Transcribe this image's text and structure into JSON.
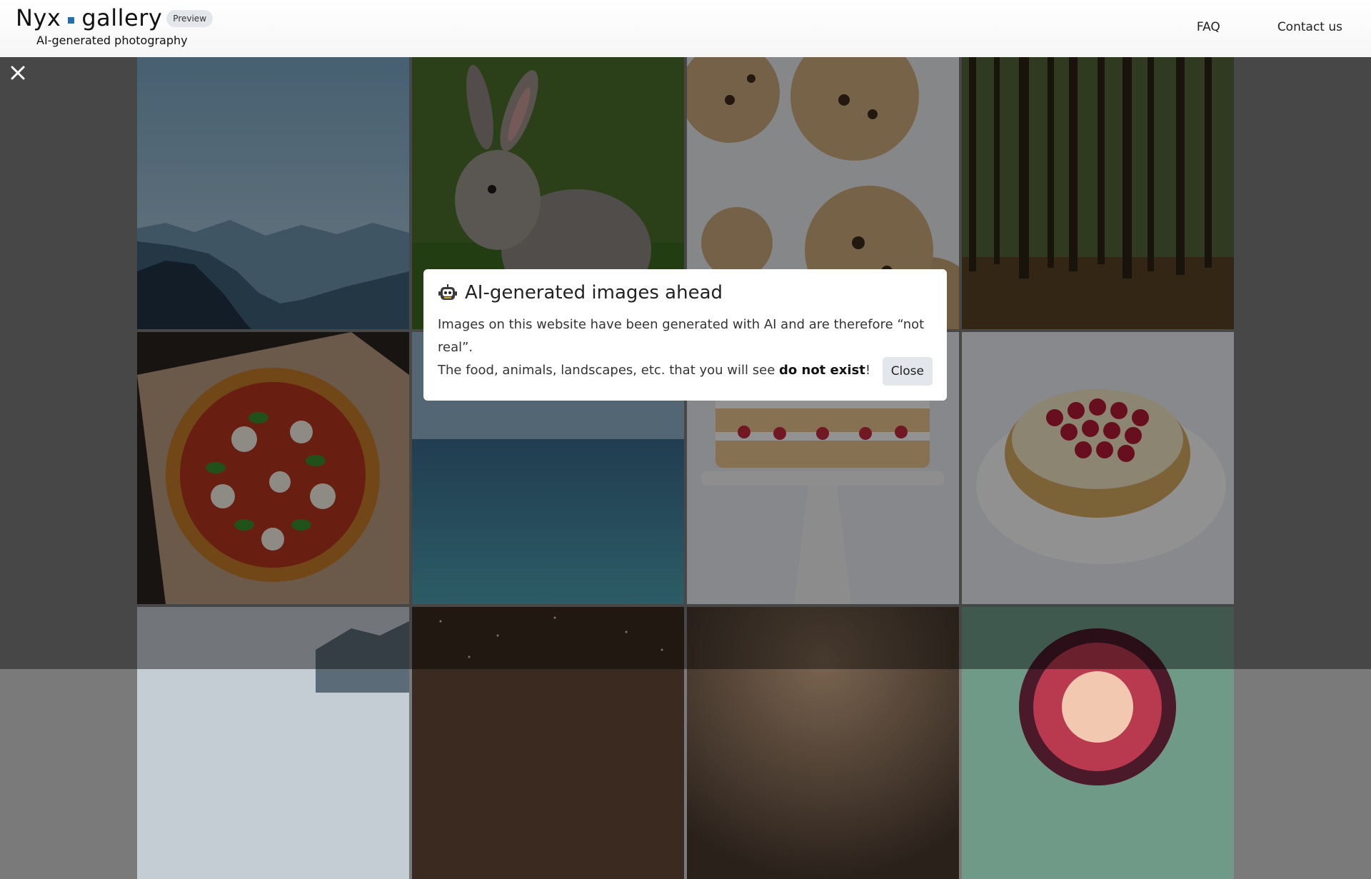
{
  "header": {
    "brand_left": "Nyx",
    "brand_right": "gallery",
    "badge": "Preview",
    "tagline": "AI-generated photography",
    "nav": [
      {
        "label": "FAQ"
      },
      {
        "label": "Contact us"
      }
    ],
    "accent_color": "#1f6fb2"
  },
  "gallery": {
    "tiles": [
      {
        "subject": "mountains"
      },
      {
        "subject": "rabbit"
      },
      {
        "subject": "cookies"
      },
      {
        "subject": "forest"
      },
      {
        "subject": "pizza"
      },
      {
        "subject": "ocean"
      },
      {
        "subject": "layer-cake"
      },
      {
        "subject": "raspberry-tart"
      },
      {
        "subject": "mountain-mist"
      },
      {
        "subject": "night-sky"
      },
      {
        "subject": "dark-gradient"
      },
      {
        "subject": "fig"
      }
    ]
  },
  "modal": {
    "icon": "robot-icon",
    "title": "AI-generated images ahead",
    "line1": "Images on this website have been generated with AI and are therefore “not real”.",
    "line2_pre": "The food, animals, landscapes, etc. that you will see ",
    "line2_bold": "do not exist",
    "line2_post": "!",
    "close_label": "Close"
  },
  "overlay": {
    "close_icon": "close-icon"
  }
}
